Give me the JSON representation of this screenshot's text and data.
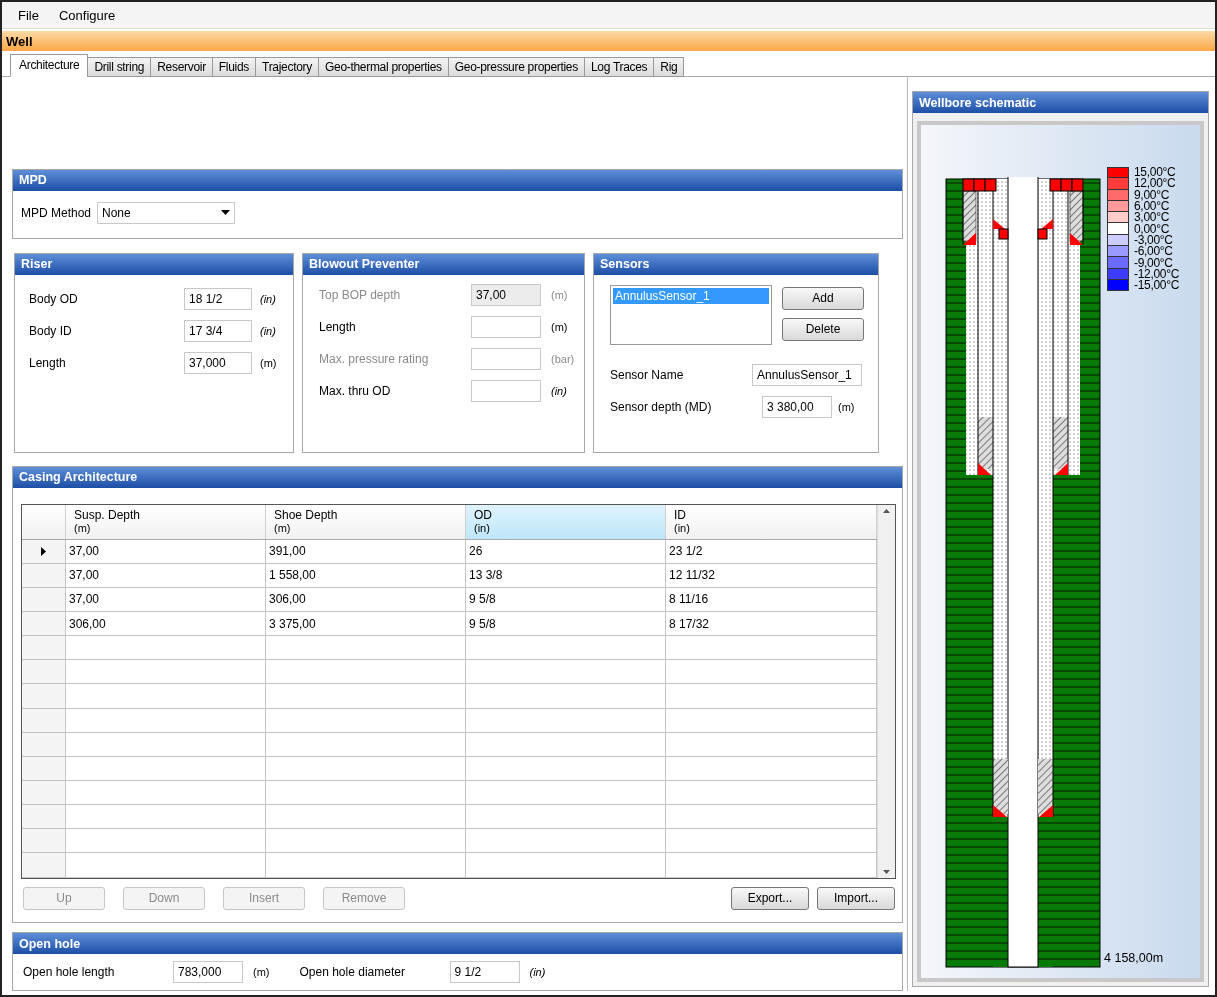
{
  "menu": [
    "File",
    "Configure"
  ],
  "window": {
    "title": "Well"
  },
  "tabs": [
    {
      "label": "Architecture",
      "selected": true
    },
    {
      "label": "Drill string",
      "selected": false
    },
    {
      "label": "Reservoir",
      "selected": false
    },
    {
      "label": "Fluids",
      "selected": false
    },
    {
      "label": "Trajectory",
      "selected": false
    },
    {
      "label": "Geo-thermal properties",
      "selected": false
    },
    {
      "label": "Geo-pressure properties",
      "selected": false
    },
    {
      "label": "Log Traces",
      "selected": false
    },
    {
      "label": "Rig",
      "selected": false
    }
  ],
  "mpd": {
    "title": "MPD",
    "label": "MPD Method",
    "value": "None"
  },
  "riser": {
    "title": "Riser",
    "fields": [
      {
        "label": "Body OD",
        "value": "18 1/2",
        "unit": "(in)",
        "italic_unit": true
      },
      {
        "label": "Body ID",
        "value": "17 3/4",
        "unit": "(in)",
        "italic_unit": true
      },
      {
        "label": "Length",
        "value": "37,000",
        "unit": "(m)",
        "italic_unit": false
      }
    ]
  },
  "blowout_preventer": {
    "title": "Blowout Preventer",
    "fields": [
      {
        "label": "Top BOP depth",
        "value": "37,00",
        "unit": "(m)",
        "italic_unit": false,
        "disabled": true,
        "readonly": true
      },
      {
        "label": "Length",
        "unit": "(m)",
        "italic_unit": false,
        "disabled": false,
        "readonly": false
      },
      {
        "label": "Max. pressure rating",
        "unit": "(bar)",
        "italic_unit": false,
        "disabled": true,
        "readonly": false
      },
      {
        "label": "Max. thru OD",
        "unit": "(in)",
        "italic_unit": true,
        "disabled": false,
        "readonly": false
      }
    ]
  },
  "sensors": {
    "title": "Sensors",
    "list": [
      {
        "label": "AnnulusSensor_1",
        "selected": true
      }
    ],
    "buttons": [
      "Add",
      "Delete"
    ],
    "fields": [
      {
        "label": "Sensor Name",
        "value": "AnnulusSensor_1"
      },
      {
        "label": "Sensor depth (MD)",
        "value": "3 380,00",
        "unit": "(m)",
        "italic_unit": false
      }
    ]
  },
  "casing": {
    "title": "Casing Architecture",
    "columns": [
      {
        "name": "Susp. Depth",
        "unit": "(m)",
        "selected": false
      },
      {
        "name": "Shoe Depth",
        "unit": "(m)",
        "selected": false
      },
      {
        "name": "OD",
        "unit": "(in)",
        "selected": true
      },
      {
        "name": "ID",
        "unit": "(in)",
        "selected": false
      }
    ],
    "rows": [
      {
        "current": true,
        "cells": [
          "37,00",
          "391,00",
          "26",
          "23 1/2"
        ]
      },
      {
        "current": false,
        "cells": [
          "37,00",
          "1 558,00",
          "13 3/8",
          "12 11/32"
        ]
      },
      {
        "current": false,
        "cells": [
          "37,00",
          "306,00",
          "9 5/8",
          "8 11/16"
        ]
      },
      {
        "current": false,
        "cells": [
          "306,00",
          "3 375,00",
          "9 5/8",
          "8 17/32"
        ]
      }
    ],
    "buttons": [
      {
        "label": "Up",
        "disabled": true
      },
      {
        "label": "Down",
        "disabled": true
      },
      {
        "label": "Insert",
        "disabled": true
      },
      {
        "label": "Remove",
        "disabled": true
      }
    ],
    "file_buttons": [
      {
        "label": "Export...",
        "disabled": false
      },
      {
        "label": "Import...",
        "disabled": false
      }
    ]
  },
  "open_hole": {
    "title": "Open hole",
    "fields": [
      {
        "label": "Open hole length",
        "value": "783,000",
        "unit": "(m)",
        "italic_unit": false
      },
      {
        "label": "Open hole diameter",
        "value": "9 1/2",
        "unit": "(in)",
        "italic_unit": true
      }
    ]
  },
  "schematic": {
    "title": "Wellbore schematic",
    "legend": [
      {
        "label": "15,00°C",
        "color": "#ff0000"
      },
      {
        "label": "12,00°C",
        "color": "#ff3c3c"
      },
      {
        "label": "9,00°C",
        "color": "#ff6a6a"
      },
      {
        "label": "6,00°C",
        "color": "#ff9a9a"
      },
      {
        "label": "3,00°C",
        "color": "#ffcccc"
      },
      {
        "label": "0,00°C",
        "color": "#ffffff"
      },
      {
        "label": "-3,00°C",
        "color": "#ccccff"
      },
      {
        "label": "-6,00°C",
        "color": "#9a9aff"
      },
      {
        "label": "-9,00°C",
        "color": "#6a6aff"
      },
      {
        "label": "-12,00°C",
        "color": "#3c3cff"
      },
      {
        "label": "-15,00°C",
        "color": "#0000ff"
      }
    ],
    "depth_label": "4 158,00m"
  }
}
